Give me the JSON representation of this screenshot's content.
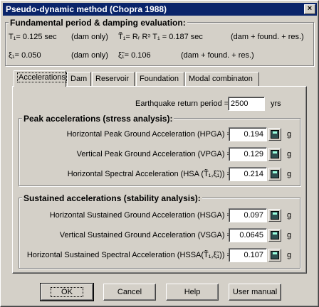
{
  "window": {
    "title": "Pseudo-dynamic method (Chopra 1988)",
    "close_glyph": "×"
  },
  "fundamental": {
    "title": "Fundamental period & damping evaluation:",
    "t1": "T₁= 0.125 sec",
    "t1_note": "(dam only)",
    "t1_tilde": "T̃₁= Rᵣ Rᵓ T₁ = 0.187 sec",
    "t1_tilde_note": "(dam + found. + res.)",
    "xi1": "ξ₁= 0.050",
    "xi1_note": "(dam only)",
    "xi1_tilde": "ξ̃₁= 0.106",
    "xi1_tilde_note": "(dam + found. + res.)"
  },
  "tabs": [
    "Accelerations",
    "Dam",
    "Reservoir",
    "Foundation",
    "Modal combinaton"
  ],
  "return_period": {
    "label": "Earthquake return period =",
    "value": "2500",
    "unit": "yrs"
  },
  "peak": {
    "title": "Peak accelerations (stress analysis):",
    "rows": [
      {
        "label": "Horizontal Peak Ground Acceleration (HPGA) =",
        "value": "0.194",
        "unit": "g"
      },
      {
        "label": "Vertical Peak Ground Acceleration (VPGA) =",
        "value": "0.129",
        "unit": "g"
      },
      {
        "label": "Horizontal Spectral Acceleration (HSA (T̃₁,ξ̃₁)) =",
        "value": "0.214",
        "unit": "g"
      }
    ]
  },
  "sustained": {
    "title": "Sustained accelerations (stability analysis):",
    "rows": [
      {
        "label": "Horizontal Sustained Ground Acceleration (HSGA) =",
        "value": "0.097",
        "unit": "g"
      },
      {
        "label": "Vertical Sustained Ground Acceleration (VSGA) =",
        "value": "0.0645",
        "unit": "g"
      },
      {
        "label": "Horizontal Sustained Spectral Acceleration (HSSA(T̃₁,ξ̃₁)) =",
        "value": "0.107",
        "unit": "g"
      }
    ]
  },
  "buttons": {
    "ok": "OK",
    "cancel": "Cancel",
    "help": "Help",
    "manual": "User manual"
  }
}
